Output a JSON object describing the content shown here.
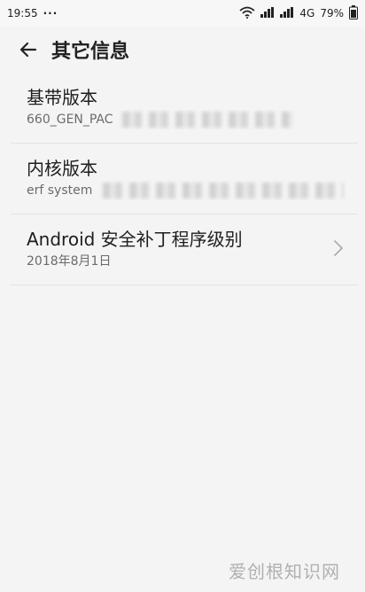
{
  "status_bar": {
    "time": "19:55",
    "dots": "···",
    "network": "4G",
    "battery": "79%"
  },
  "header": {
    "title": "其它信息"
  },
  "items": [
    {
      "title": "基带版本",
      "subtitle": "660_GEN_PAC"
    },
    {
      "title": "内核版本",
      "subtitle": "erf system"
    },
    {
      "title": "Android 安全补丁程序级别",
      "subtitle": "2018年8月1日"
    }
  ],
  "watermark": "爱创根知识网"
}
